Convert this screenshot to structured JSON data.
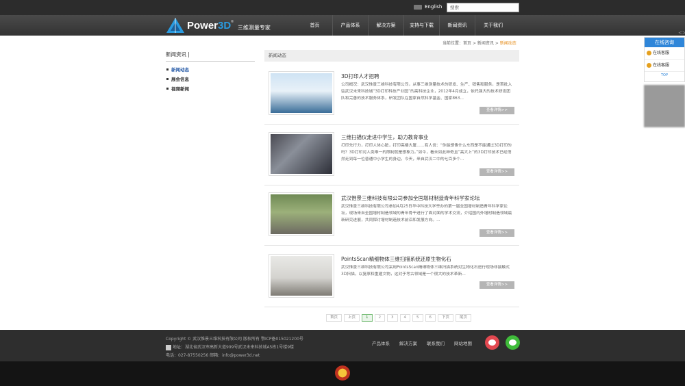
{
  "topbar": {
    "lang_label": "English",
    "search_placeholder": "搜索"
  },
  "header": {
    "logo_text": "Power",
    "logo_3d": "3D",
    "logo_reg": "®",
    "logo_sub": "三维测量专家",
    "nav": [
      "首页",
      "产品体系",
      "解决方案",
      "支持与下载",
      "新闻资讯",
      "关于我们"
    ]
  },
  "side_service": {
    "header": "在线咨询",
    "items": [
      "在线客服",
      "在线客服"
    ],
    "top": "TOP",
    "edge_text": "<>"
  },
  "breadcrumb": {
    "prefix": "当前位置：",
    "home": "首页",
    "sep1": " > ",
    "news": "新闻资讯",
    "sep2": " > ",
    "current": "新闻动态"
  },
  "sidebar": {
    "title": "新闻资讯 |",
    "items": [
      "新闻动态",
      "展会信息",
      "视频新闻"
    ]
  },
  "main": {
    "heading": "新闻动态",
    "more_label": "查看详情>>",
    "articles": [
      {
        "title": "3D打印人才招聘",
        "desc": "公司概况：武汉惟景三维科技有限公司，从事三维测量技术的研发、生产、销售和服务，是首批入驻武汉未来科技城“3D打印科技产业园”的高科技企业，2012年4月成立，依托强大的技术研发团队和完善的技术服务体系，研发团队在国家自然科学基金、国家863..."
      },
      {
        "title": "三维扫描仪走进中学生，助力教育事业",
        "desc": "打印先行力，打印人体心脏，打印高楼大厦……有人说：“你能想像什么东西是不能通过3D打印的吗？3D打印对人类唯一的限制就是想象力。”如今，看未如此神奇且“高大上”的3D打印技术已经悄然走到每一位普通中小学生的身边，今天，来自武汉二中的七百多个..."
      },
      {
        "title": "武汉惟景三维科技有限公司参加全国增材制造青年科学家论坛",
        "desc": "武汉惟景三维科技有限公司参加4月25日华中科技大学举办的第一届全国增材制造青年科学家论坛，现场来自全国增材制造领域的青年骨干进行了面对面的学术交流，介绍国内外增材制造领域最新研究进展，共同探讨增材制造技术前沿和发展方向。..."
      },
      {
        "title": "PointsScan精细物体三维扫描系统还原生物化石",
        "desc": "武汉惟景三维科技有限公司采用PointsScan精细物体三维扫描系统对生物化石进行现场非接触式3D扫描，以复原和重建文物，这对于考古领域是一个很大的技术革新..."
      }
    ]
  },
  "pager": [
    "首页",
    "上页",
    "1",
    "2",
    "3",
    "4",
    "5",
    "6",
    "下页",
    "尾页"
  ],
  "footer": {
    "copyright": "Copyright © 武汉惟景三维科技有限公司 版权所有 鄂ICP备015021200号",
    "address": "地址：湖北省武汉市高新大道999号武汉未来科技城A5栋1号楼9楼",
    "contact": "电话：027-87550256 邮箱：info@power3d.net",
    "links": [
      "产品体系",
      "解决方案",
      "联系我们",
      "网站地图"
    ]
  },
  "colors": {
    "accent": "#2a9be0",
    "panel": "#2f86d9",
    "highlight": "#e58b17",
    "weibo": "#e24850",
    "weixin": "#3fbc3a"
  }
}
